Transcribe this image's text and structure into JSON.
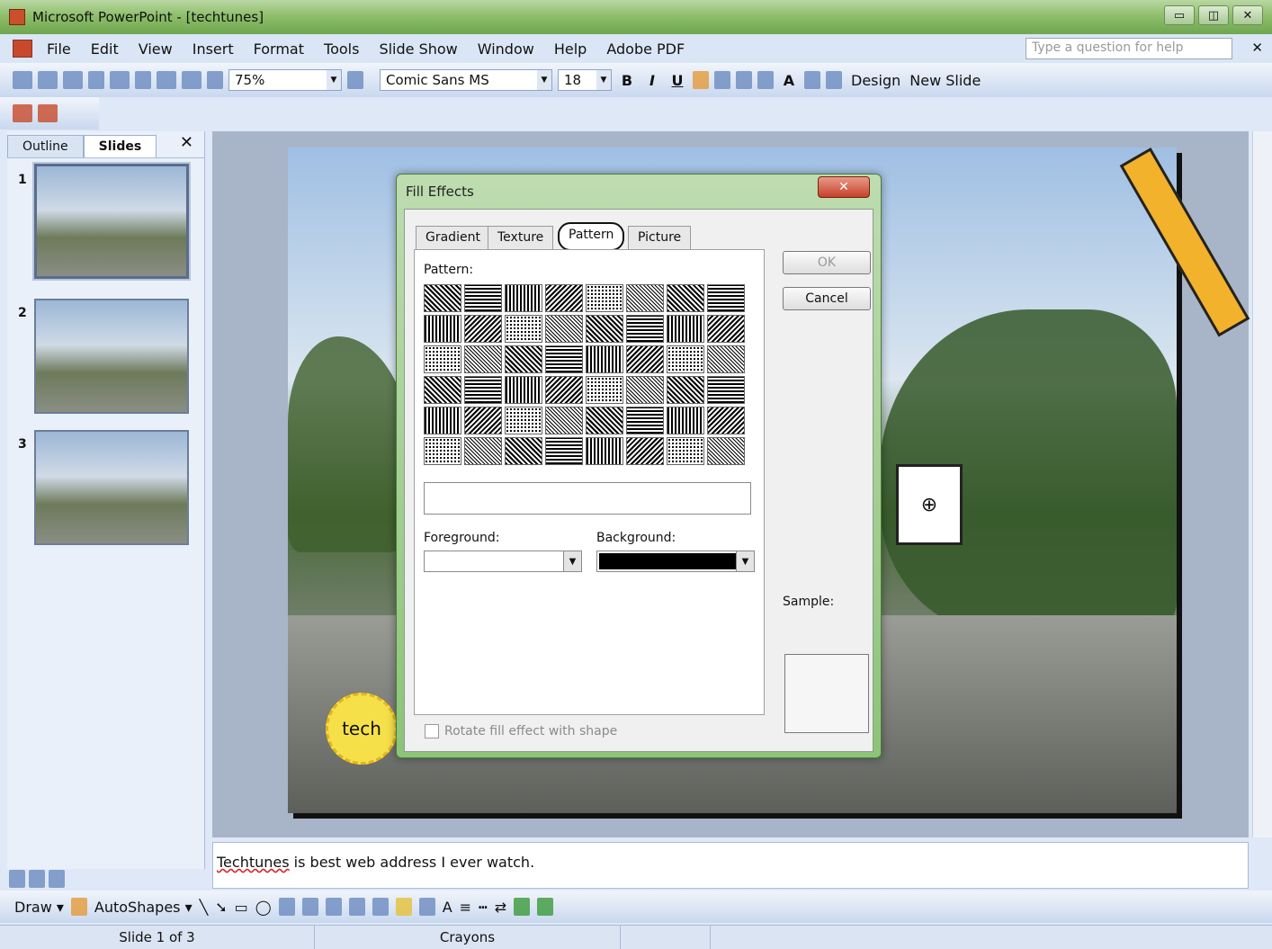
{
  "window": {
    "title": "Microsoft PowerPoint - [techtunes]",
    "controls": [
      "▭",
      "◫",
      "✕"
    ]
  },
  "menu": {
    "items": [
      "File",
      "Edit",
      "View",
      "Insert",
      "Format",
      "Tools",
      "Slide Show",
      "Window",
      "Help",
      "Adobe PDF"
    ],
    "help_placeholder": "Type a question for help",
    "close": "✕"
  },
  "toolbar": {
    "zoom": "75%",
    "font": "Comic Sans MS",
    "size": "18",
    "bold": "B",
    "italic": "I",
    "underline": "U",
    "grow_font": "A",
    "design": "Design",
    "new_slide": "New Slide"
  },
  "left_pane": {
    "tabs": [
      "Outline",
      "Slides"
    ],
    "active_tab": "Slides",
    "close": "✕",
    "slides": [
      {
        "num": "1",
        "selected": true
      },
      {
        "num": "2",
        "selected": false
      },
      {
        "num": "3",
        "selected": false
      }
    ]
  },
  "slide": {
    "seal_text": "tech"
  },
  "notes": {
    "typo_word": "Techtunes",
    "rest": " is best web address I ever watch."
  },
  "draw_toolbar": {
    "draw": "Draw ▾",
    "autoshapes": "AutoShapes ▾"
  },
  "status": {
    "slide": "Slide 1 of 3",
    "design": "Crayons"
  },
  "dialog": {
    "title": "Fill Effects",
    "close": "✕",
    "tabs": [
      "Gradient",
      "Texture",
      "Pattern",
      "Picture"
    ],
    "active_tab": "Pattern",
    "pattern_label": "Pattern:",
    "foreground_label": "Foreground:",
    "background_label": "Background:",
    "foreground_color": "#ffffff",
    "background_color": "#000000",
    "ok": "OK",
    "cancel": "Cancel",
    "sample_label": "Sample:",
    "rotate_label": "Rotate fill effect with shape",
    "pattern_count": 48
  }
}
